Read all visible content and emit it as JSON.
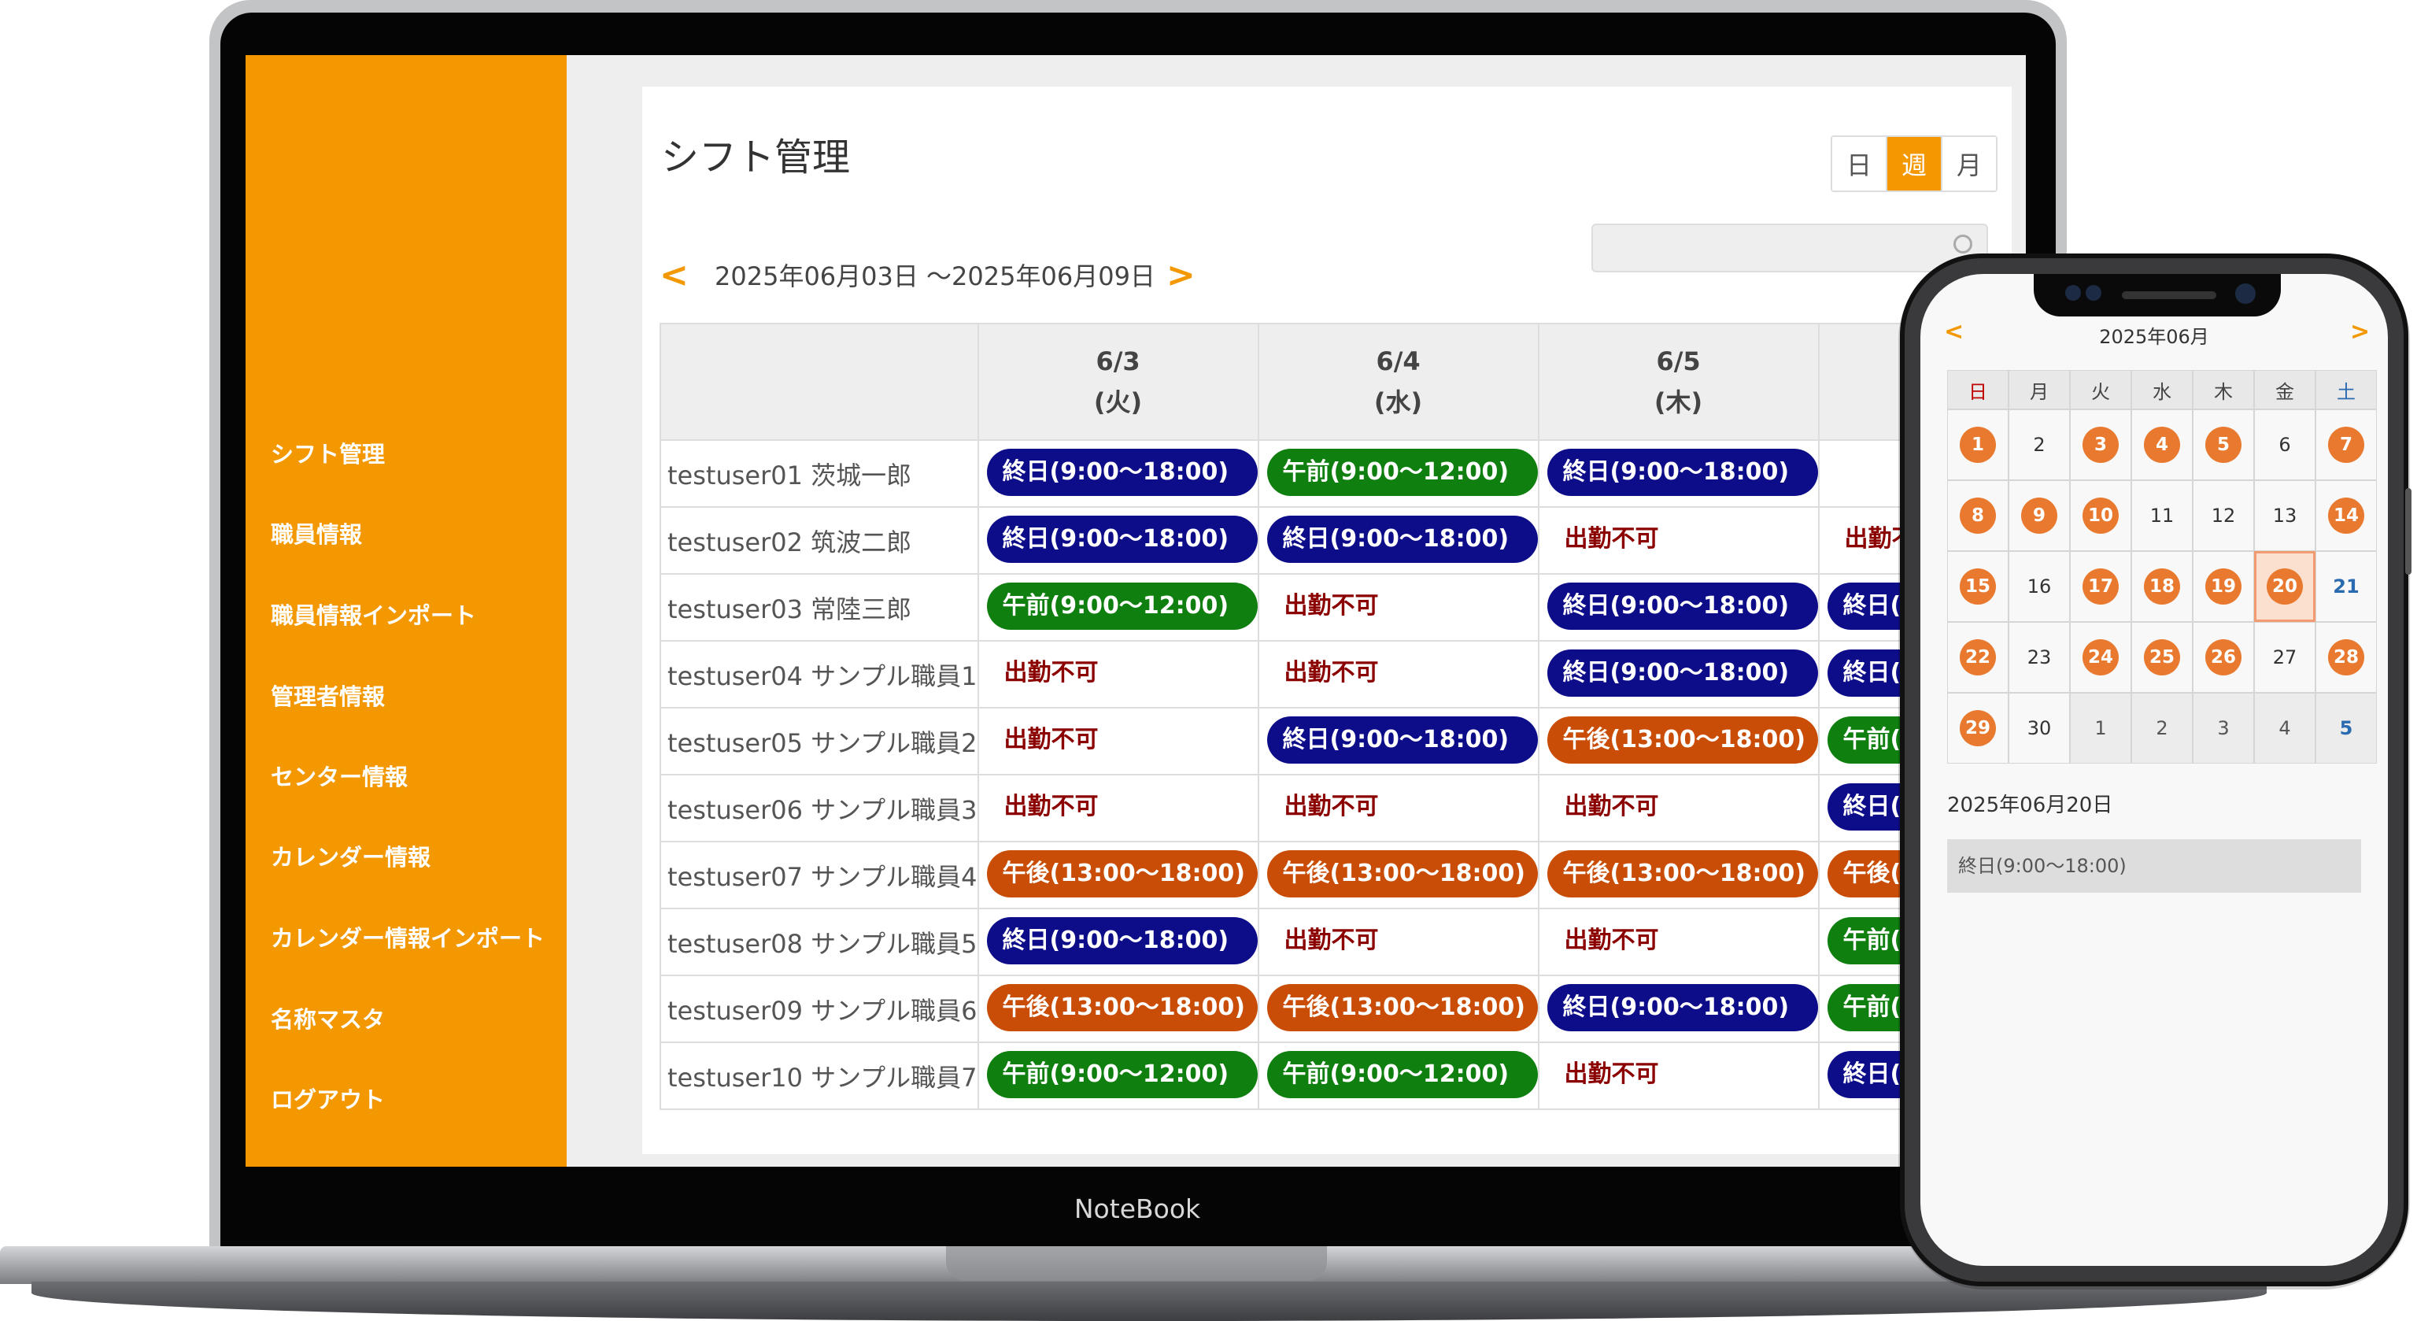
{
  "device_label": "NoteBook",
  "sidebar": {
    "items": [
      "シフト管理",
      "職員情報",
      "職員情報インポート",
      "管理者情報",
      "センター情報",
      "カレンダー情報",
      "カレンダー情報インポート",
      "名称マスタ",
      "ログアウト"
    ]
  },
  "page": {
    "title": "シフト管理",
    "view_toggle": [
      "日",
      "週",
      "月"
    ],
    "active_view": "週",
    "prev_label": "<",
    "next_label": ">",
    "date_range": "2025年06月03日 〜2025年06月09日",
    "search_placeholder": ""
  },
  "table": {
    "columns": [
      {
        "date": "6/3",
        "dow": "(火)"
      },
      {
        "date": "6/4",
        "dow": "(水)"
      },
      {
        "date": "6/5",
        "dow": "(木)"
      }
    ],
    "rows": [
      {
        "user": "testuser01 茨城一郎",
        "cells": [
          [
            "full",
            "終日(9:00〜18:00)"
          ],
          [
            "am",
            "午前(9:00〜12:00)"
          ],
          [
            "full",
            "終日(9:00〜18:00)"
          ],
          [
            "empty",
            ""
          ]
        ]
      },
      {
        "user": "testuser02 筑波二郎",
        "cells": [
          [
            "full",
            "終日(9:00〜18:00)"
          ],
          [
            "full",
            "終日(9:00〜18:00)"
          ],
          [
            "na",
            "出勤不可"
          ],
          [
            "na",
            "出勤不可"
          ]
        ]
      },
      {
        "user": "testuser03 常陸三郎",
        "cells": [
          [
            "am",
            "午前(9:00〜12:00)"
          ],
          [
            "na",
            "出勤不可"
          ],
          [
            "full",
            "終日(9:00〜18:00)"
          ],
          [
            "full",
            "終日(9:00〜18:00)"
          ]
        ]
      },
      {
        "user": "testuser04 サンプル職員1",
        "cells": [
          [
            "na",
            "出勤不可"
          ],
          [
            "na",
            "出勤不可"
          ],
          [
            "full",
            "終日(9:00〜18:00)"
          ],
          [
            "full",
            "終日(9:00〜18:00)"
          ]
        ]
      },
      {
        "user": "testuser05 サンプル職員2",
        "cells": [
          [
            "na",
            "出勤不可"
          ],
          [
            "full",
            "終日(9:00〜18:00)"
          ],
          [
            "pm",
            "午後(13:00〜18:00)"
          ],
          [
            "am",
            "午前(9:00〜12:00)"
          ]
        ]
      },
      {
        "user": "testuser06 サンプル職員3",
        "cells": [
          [
            "na",
            "出勤不可"
          ],
          [
            "na",
            "出勤不可"
          ],
          [
            "na",
            "出勤不可"
          ],
          [
            "full",
            "終日(9:00〜18:00)"
          ]
        ]
      },
      {
        "user": "testuser07 サンプル職員4",
        "cells": [
          [
            "pm",
            "午後(13:00〜18:00)"
          ],
          [
            "pm",
            "午後(13:00〜18:00)"
          ],
          [
            "pm",
            "午後(13:00〜18:00)"
          ],
          [
            "pm",
            "午後(13:00〜18:00)"
          ]
        ]
      },
      {
        "user": "testuser08 サンプル職員5",
        "cells": [
          [
            "full",
            "終日(9:00〜18:00)"
          ],
          [
            "na",
            "出勤不可"
          ],
          [
            "na",
            "出勤不可"
          ],
          [
            "am",
            "午前(9:00〜12:00)"
          ]
        ]
      },
      {
        "user": "testuser09 サンプル職員6",
        "cells": [
          [
            "pm",
            "午後(13:00〜18:00)"
          ],
          [
            "pm",
            "午後(13:00〜18:00)"
          ],
          [
            "full",
            "終日(9:00〜18:00)"
          ],
          [
            "am",
            "午前(9:00〜12:00)"
          ]
        ]
      },
      {
        "user": "testuser10 サンプル職員7",
        "cells": [
          [
            "am",
            "午前(9:00〜12:00)"
          ],
          [
            "am",
            "午前(9:00〜12:00)"
          ],
          [
            "na",
            "出勤不可"
          ],
          [
            "full",
            "終日(9:00〜18:00)"
          ]
        ]
      }
    ]
  },
  "phone_calendar": {
    "prev_label": "<",
    "next_label": ">",
    "month_label": "2025年06月",
    "weekdays": [
      "日",
      "月",
      "火",
      "水",
      "木",
      "金",
      "土"
    ],
    "days": [
      {
        "n": "1",
        "shift": true
      },
      {
        "n": "2"
      },
      {
        "n": "3",
        "shift": true
      },
      {
        "n": "4",
        "shift": true
      },
      {
        "n": "5",
        "shift": true
      },
      {
        "n": "6"
      },
      {
        "n": "7",
        "shift": true
      },
      {
        "n": "8",
        "shift": true
      },
      {
        "n": "9",
        "shift": true
      },
      {
        "n": "10",
        "shift": true
      },
      {
        "n": "11"
      },
      {
        "n": "12"
      },
      {
        "n": "13"
      },
      {
        "n": "14",
        "shift": true
      },
      {
        "n": "15",
        "shift": true
      },
      {
        "n": "16"
      },
      {
        "n": "17",
        "shift": true
      },
      {
        "n": "18",
        "shift": true
      },
      {
        "n": "19",
        "shift": true
      },
      {
        "n": "20",
        "shift": true,
        "selected": true
      },
      {
        "n": "21"
      },
      {
        "n": "22",
        "shift": true
      },
      {
        "n": "23"
      },
      {
        "n": "24",
        "shift": true
      },
      {
        "n": "25",
        "shift": true
      },
      {
        "n": "26",
        "shift": true
      },
      {
        "n": "27"
      },
      {
        "n": "28",
        "shift": true
      },
      {
        "n": "29",
        "shift": true
      },
      {
        "n": "30"
      },
      {
        "n": "1",
        "other": true
      },
      {
        "n": "2",
        "other": true
      },
      {
        "n": "3",
        "other": true
      },
      {
        "n": "4",
        "other": true
      },
      {
        "n": "5",
        "other": true
      }
    ],
    "selected_date": "2025年06月20日",
    "selected_detail": "終日(9:00〜18:00)"
  }
}
